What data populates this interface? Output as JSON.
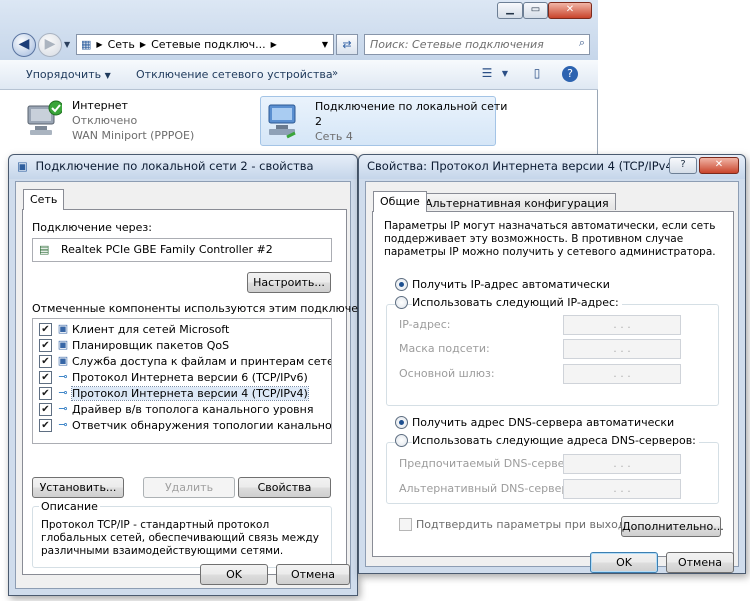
{
  "explorer": {
    "breadcrumb": [
      "Сеть",
      "Сетевые подключ..."
    ],
    "search_placeholder": "Поиск: Сетевые подключения",
    "toolbar": {
      "organize": "Упорядочить",
      "disconnect": "Отключение сетевого устройства"
    },
    "connections": [
      {
        "name": "Интернет",
        "status": "Отключено",
        "device": "WAN Miniport (PPPOE)"
      },
      {
        "name": "Подключение по локальной сети",
        "name_line2": "2",
        "status": "Сеть  4"
      }
    ]
  },
  "props": {
    "title": "Подключение по локальной сети 2 - свойства",
    "tab": "Сеть",
    "connect_via_label": "Подключение через:",
    "adapter": "Realtek PCIe GBE Family Controller #2",
    "configure_btn": "Настроить...",
    "components_label": "Отмеченные компоненты используются этим подключением:",
    "components": [
      {
        "name": "Клиент для сетей Microsoft",
        "checked": true,
        "icon": "network-client-icon"
      },
      {
        "name": "Планировщик пакетов QoS",
        "checked": true,
        "icon": "network-service-icon"
      },
      {
        "name": "Служба доступа к файлам и принтерам сетей Micro...",
        "checked": true,
        "icon": "network-service-icon"
      },
      {
        "name": "Протокол Интернета версии 6 (TCP/IPv6)",
        "checked": true,
        "icon": "protocol-icon"
      },
      {
        "name": "Протокол Интернета версии 4 (TCP/IPv4)",
        "checked": true,
        "icon": "protocol-icon",
        "selected": true
      },
      {
        "name": "Драйвер в/в тополога канального уровня",
        "checked": true,
        "icon": "protocol-icon"
      },
      {
        "name": "Ответчик обнаружения топологии канального уровня",
        "checked": true,
        "icon": "protocol-icon"
      }
    ],
    "install_btn": "Установить...",
    "remove_btn": "Удалить",
    "properties_btn": "Свойства",
    "description_label": "Описание",
    "description": "Протокол TCP/IP - стандартный протокол глобальных сетей, обеспечивающий связь между различными взаимодействующими сетями.",
    "ok": "OK",
    "cancel": "Отмена"
  },
  "ipv4": {
    "title": "Свойства: Протокол Интернета версии 4 (TCP/IPv4)",
    "tabs": [
      "Общие",
      "Альтернативная конфигурация"
    ],
    "intro": "Параметры IP могут назначаться автоматически, если сеть поддерживает эту возможность. В противном случае параметры IP можно получить у сетевого администратора.",
    "auto_ip": "Получить IP-адрес автоматически",
    "manual_ip": "Использовать следующий IP-адрес:",
    "ip_label": "IP-адрес:",
    "mask_label": "Маска подсети:",
    "gateway_label": "Основной шлюз:",
    "auto_dns": "Получить адрес DNS-сервера автоматически",
    "manual_dns": "Использовать следующие адреса DNS-серверов:",
    "pref_dns_label": "Предпочитаемый DNS-сервер:",
    "alt_dns_label": "Альтернативный DNS-сервер:",
    "ip_dots": ".   .   .",
    "validate": "Подтвердить параметры при выходе",
    "advanced_btn": "Дополнительно...",
    "ok": "OK",
    "cancel": "Отмена",
    "help_btn": "?",
    "close_btn": "✕"
  },
  "colors": {
    "accent": "#3c7fb1",
    "selection": "#dde9f7",
    "frame": "#cfdcec"
  }
}
